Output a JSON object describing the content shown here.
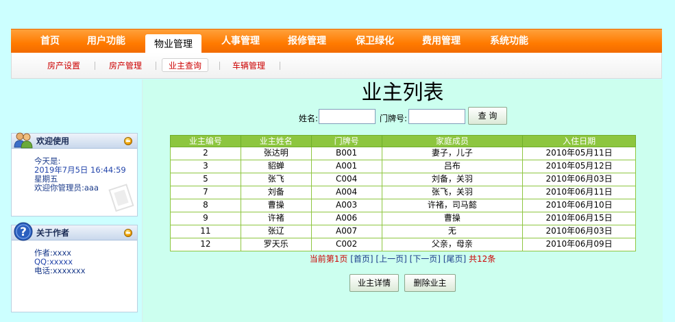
{
  "topnav": {
    "items": [
      "首页",
      "用户功能",
      "物业管理",
      "人事管理",
      "报修管理",
      "保卫绿化",
      "费用管理",
      "系统功能"
    ],
    "active_index": 2
  },
  "subnav": {
    "items": [
      "房产设置",
      "房产管理",
      "业主查询",
      "车辆管理"
    ],
    "active_index": 2
  },
  "sidebar": {
    "welcome": {
      "title": "欢迎使用",
      "today_label": "今天是:",
      "datetime": "2019年7月5日  16:44:59",
      "weekday": "星期五",
      "greeting": "欢迎你管理员:aaa"
    },
    "about": {
      "title": "关于作者",
      "author": "作者:xxxx",
      "qq": "QQ:xxxxx",
      "phone": "电话:xxxxxxx"
    }
  },
  "main": {
    "title": "业主列表",
    "search": {
      "name_label": "姓名:",
      "name_value": "",
      "door_label": "门牌号:",
      "door_value": "",
      "query_button": "查 询"
    },
    "table": {
      "headers": [
        "业主编号",
        "业主姓名",
        "门牌号",
        "家庭成员",
        "入住日期"
      ],
      "rows": [
        [
          "2",
          "张达明",
          "B001",
          "妻子，儿子",
          "2010年05月11日"
        ],
        [
          "3",
          "貂蝉",
          "A001",
          "吕布",
          "2010年05月12日"
        ],
        [
          "5",
          "张飞",
          "C004",
          "刘备，关羽",
          "2010年06月03日"
        ],
        [
          "7",
          "刘备",
          "A004",
          "张飞，关羽",
          "2010年06月11日"
        ],
        [
          "8",
          "曹操",
          "A003",
          "许褚，司马懿",
          "2010年06月10日"
        ],
        [
          "9",
          "许褚",
          "A006",
          "曹操",
          "2010年06月15日"
        ],
        [
          "11",
          "张辽",
          "A007",
          "无",
          "2010年06月03日"
        ],
        [
          "12",
          "罗天乐",
          "C002",
          "父亲，母亲",
          "2010年06月09日"
        ]
      ]
    },
    "pager": {
      "current": "当前第1页",
      "first": "[首页]",
      "prev": "[上一页]",
      "next": "[下一页]",
      "last": "[尾页]",
      "total": "共12条"
    },
    "buttons": {
      "detail": "业主详情",
      "delete": "删除业主"
    }
  },
  "colors": {
    "nav_orange": "#ff7a00",
    "header_green": "#8dc63f",
    "link_red": "#cc0000",
    "background": "#ccffff"
  }
}
